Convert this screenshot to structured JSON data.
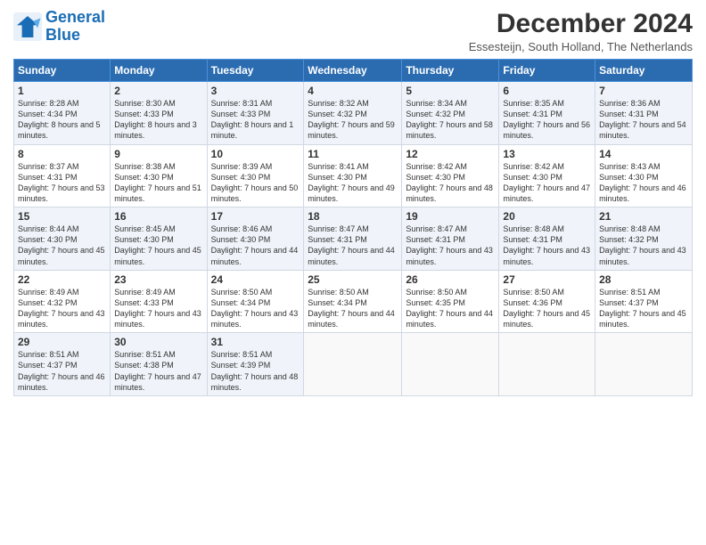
{
  "header": {
    "logo_text_general": "General",
    "logo_text_blue": "Blue",
    "month_title": "December 2024",
    "subtitle": "Essesteijn, South Holland, The Netherlands"
  },
  "days_of_week": [
    "Sunday",
    "Monday",
    "Tuesday",
    "Wednesday",
    "Thursday",
    "Friday",
    "Saturday"
  ],
  "weeks": [
    [
      {
        "day": "1",
        "sunrise": "Sunrise: 8:28 AM",
        "sunset": "Sunset: 4:34 PM",
        "daylight": "Daylight: 8 hours and 5 minutes."
      },
      {
        "day": "2",
        "sunrise": "Sunrise: 8:30 AM",
        "sunset": "Sunset: 4:33 PM",
        "daylight": "Daylight: 8 hours and 3 minutes."
      },
      {
        "day": "3",
        "sunrise": "Sunrise: 8:31 AM",
        "sunset": "Sunset: 4:33 PM",
        "daylight": "Daylight: 8 hours and 1 minute."
      },
      {
        "day": "4",
        "sunrise": "Sunrise: 8:32 AM",
        "sunset": "Sunset: 4:32 PM",
        "daylight": "Daylight: 7 hours and 59 minutes."
      },
      {
        "day": "5",
        "sunrise": "Sunrise: 8:34 AM",
        "sunset": "Sunset: 4:32 PM",
        "daylight": "Daylight: 7 hours and 58 minutes."
      },
      {
        "day": "6",
        "sunrise": "Sunrise: 8:35 AM",
        "sunset": "Sunset: 4:31 PM",
        "daylight": "Daylight: 7 hours and 56 minutes."
      },
      {
        "day": "7",
        "sunrise": "Sunrise: 8:36 AM",
        "sunset": "Sunset: 4:31 PM",
        "daylight": "Daylight: 7 hours and 54 minutes."
      }
    ],
    [
      {
        "day": "8",
        "sunrise": "Sunrise: 8:37 AM",
        "sunset": "Sunset: 4:31 PM",
        "daylight": "Daylight: 7 hours and 53 minutes."
      },
      {
        "day": "9",
        "sunrise": "Sunrise: 8:38 AM",
        "sunset": "Sunset: 4:30 PM",
        "daylight": "Daylight: 7 hours and 51 minutes."
      },
      {
        "day": "10",
        "sunrise": "Sunrise: 8:39 AM",
        "sunset": "Sunset: 4:30 PM",
        "daylight": "Daylight: 7 hours and 50 minutes."
      },
      {
        "day": "11",
        "sunrise": "Sunrise: 8:41 AM",
        "sunset": "Sunset: 4:30 PM",
        "daylight": "Daylight: 7 hours and 49 minutes."
      },
      {
        "day": "12",
        "sunrise": "Sunrise: 8:42 AM",
        "sunset": "Sunset: 4:30 PM",
        "daylight": "Daylight: 7 hours and 48 minutes."
      },
      {
        "day": "13",
        "sunrise": "Sunrise: 8:42 AM",
        "sunset": "Sunset: 4:30 PM",
        "daylight": "Daylight: 7 hours and 47 minutes."
      },
      {
        "day": "14",
        "sunrise": "Sunrise: 8:43 AM",
        "sunset": "Sunset: 4:30 PM",
        "daylight": "Daylight: 7 hours and 46 minutes."
      }
    ],
    [
      {
        "day": "15",
        "sunrise": "Sunrise: 8:44 AM",
        "sunset": "Sunset: 4:30 PM",
        "daylight": "Daylight: 7 hours and 45 minutes."
      },
      {
        "day": "16",
        "sunrise": "Sunrise: 8:45 AM",
        "sunset": "Sunset: 4:30 PM",
        "daylight": "Daylight: 7 hours and 45 minutes."
      },
      {
        "day": "17",
        "sunrise": "Sunrise: 8:46 AM",
        "sunset": "Sunset: 4:30 PM",
        "daylight": "Daylight: 7 hours and 44 minutes."
      },
      {
        "day": "18",
        "sunrise": "Sunrise: 8:47 AM",
        "sunset": "Sunset: 4:31 PM",
        "daylight": "Daylight: 7 hours and 44 minutes."
      },
      {
        "day": "19",
        "sunrise": "Sunrise: 8:47 AM",
        "sunset": "Sunset: 4:31 PM",
        "daylight": "Daylight: 7 hours and 43 minutes."
      },
      {
        "day": "20",
        "sunrise": "Sunrise: 8:48 AM",
        "sunset": "Sunset: 4:31 PM",
        "daylight": "Daylight: 7 hours and 43 minutes."
      },
      {
        "day": "21",
        "sunrise": "Sunrise: 8:48 AM",
        "sunset": "Sunset: 4:32 PM",
        "daylight": "Daylight: 7 hours and 43 minutes."
      }
    ],
    [
      {
        "day": "22",
        "sunrise": "Sunrise: 8:49 AM",
        "sunset": "Sunset: 4:32 PM",
        "daylight": "Daylight: 7 hours and 43 minutes."
      },
      {
        "day": "23",
        "sunrise": "Sunrise: 8:49 AM",
        "sunset": "Sunset: 4:33 PM",
        "daylight": "Daylight: 7 hours and 43 minutes."
      },
      {
        "day": "24",
        "sunrise": "Sunrise: 8:50 AM",
        "sunset": "Sunset: 4:34 PM",
        "daylight": "Daylight: 7 hours and 43 minutes."
      },
      {
        "day": "25",
        "sunrise": "Sunrise: 8:50 AM",
        "sunset": "Sunset: 4:34 PM",
        "daylight": "Daylight: 7 hours and 44 minutes."
      },
      {
        "day": "26",
        "sunrise": "Sunrise: 8:50 AM",
        "sunset": "Sunset: 4:35 PM",
        "daylight": "Daylight: 7 hours and 44 minutes."
      },
      {
        "day": "27",
        "sunrise": "Sunrise: 8:50 AM",
        "sunset": "Sunset: 4:36 PM",
        "daylight": "Daylight: 7 hours and 45 minutes."
      },
      {
        "day": "28",
        "sunrise": "Sunrise: 8:51 AM",
        "sunset": "Sunset: 4:37 PM",
        "daylight": "Daylight: 7 hours and 45 minutes."
      }
    ],
    [
      {
        "day": "29",
        "sunrise": "Sunrise: 8:51 AM",
        "sunset": "Sunset: 4:37 PM",
        "daylight": "Daylight: 7 hours and 46 minutes."
      },
      {
        "day": "30",
        "sunrise": "Sunrise: 8:51 AM",
        "sunset": "Sunset: 4:38 PM",
        "daylight": "Daylight: 7 hours and 47 minutes."
      },
      {
        "day": "31",
        "sunrise": "Sunrise: 8:51 AM",
        "sunset": "Sunset: 4:39 PM",
        "daylight": "Daylight: 7 hours and 48 minutes."
      },
      null,
      null,
      null,
      null
    ]
  ]
}
